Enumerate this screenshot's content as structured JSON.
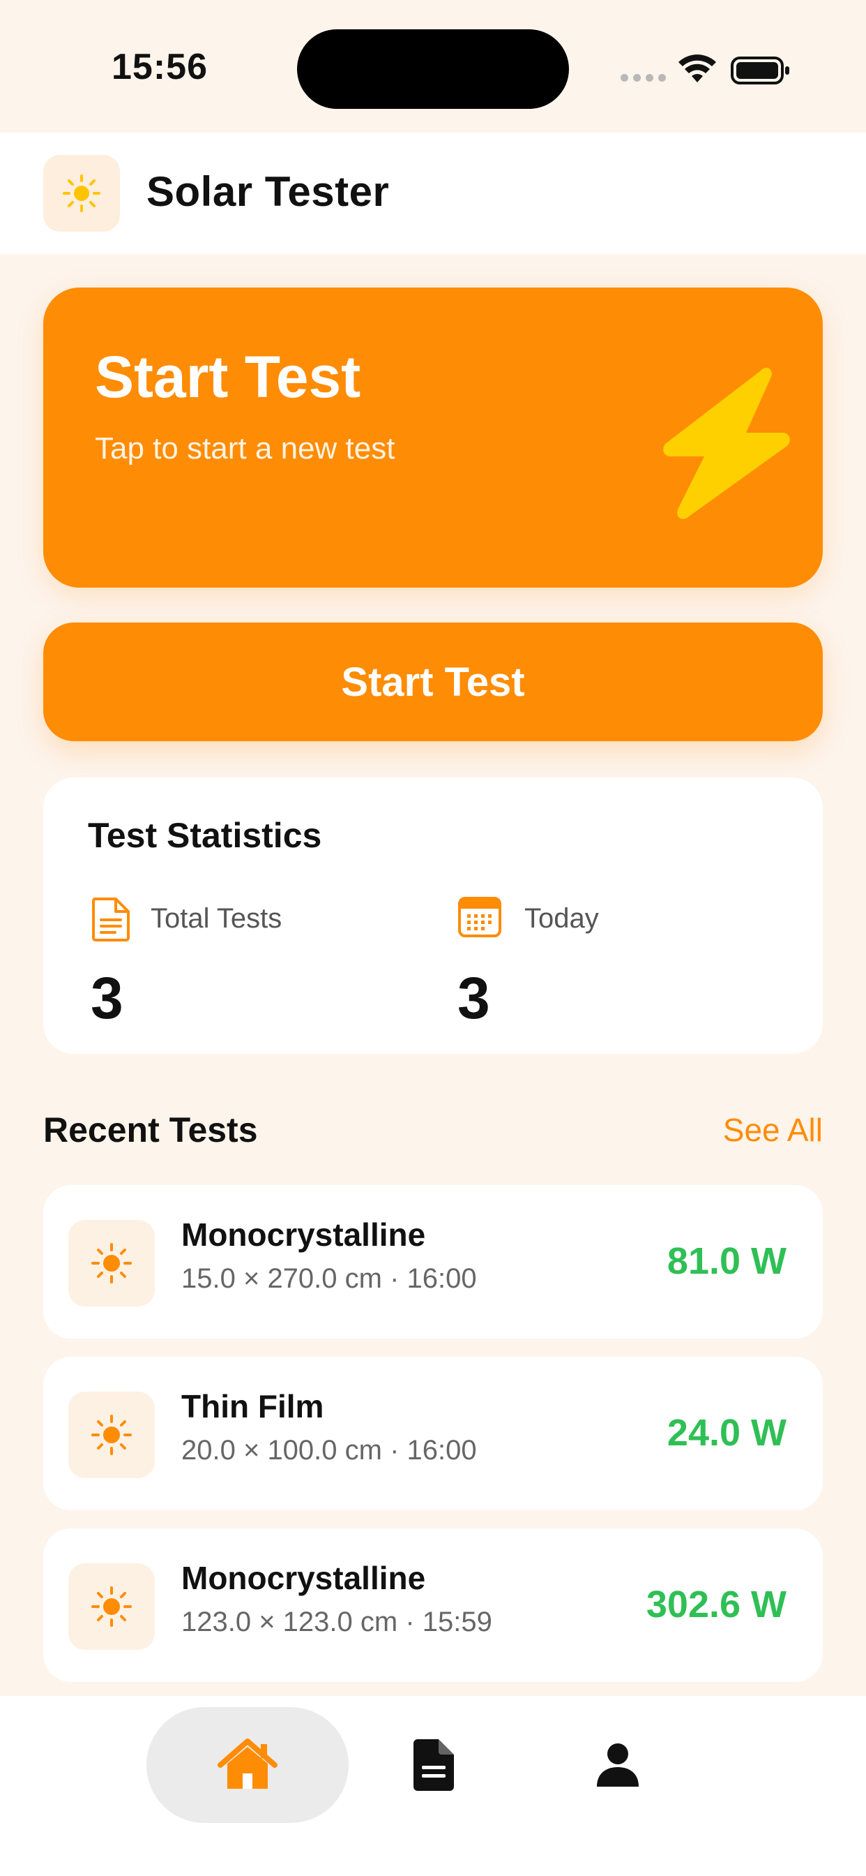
{
  "status_bar": {
    "time": "15:56"
  },
  "header": {
    "app_icon": "sun-icon",
    "title": "Solar Tester"
  },
  "hero": {
    "title": "Start Test",
    "subtitle": "Tap to start a new test",
    "icon": "lightning-bolt-icon",
    "background": "#ff8c05",
    "bolt_color": "#ffd000"
  },
  "start_button": {
    "label": "Start Test"
  },
  "stats": {
    "title": "Test Statistics",
    "total": {
      "label": "Total Tests",
      "value": "3",
      "icon": "document-icon"
    },
    "today": {
      "label": "Today",
      "value": "3",
      "icon": "calendar-icon"
    }
  },
  "recent": {
    "title": "Recent Tests",
    "see_all": "See All",
    "items": [
      {
        "name": "Monocrystalline",
        "meta": "15.0 × 270.0 cm · 16:00",
        "power": "81.0 W",
        "icon": "sun-icon"
      },
      {
        "name": "Thin Film",
        "meta": "20.0 × 100.0 cm · 16:00",
        "power": "24.0 W",
        "icon": "sun-icon"
      },
      {
        "name": "Monocrystalline",
        "meta": "123.0 × 123.0 cm · 15:59",
        "power": "302.6 W",
        "icon": "sun-icon"
      }
    ]
  },
  "tab_bar": {
    "tabs": [
      {
        "id": "home",
        "icon": "home-icon",
        "selected": true
      },
      {
        "id": "reports",
        "icon": "document-icon",
        "selected": false
      },
      {
        "id": "profile",
        "icon": "person-icon",
        "selected": false
      }
    ]
  },
  "colors": {
    "accent": "#ff8c05",
    "power_green": "#2fbf55",
    "background": "#fdf4ec"
  }
}
